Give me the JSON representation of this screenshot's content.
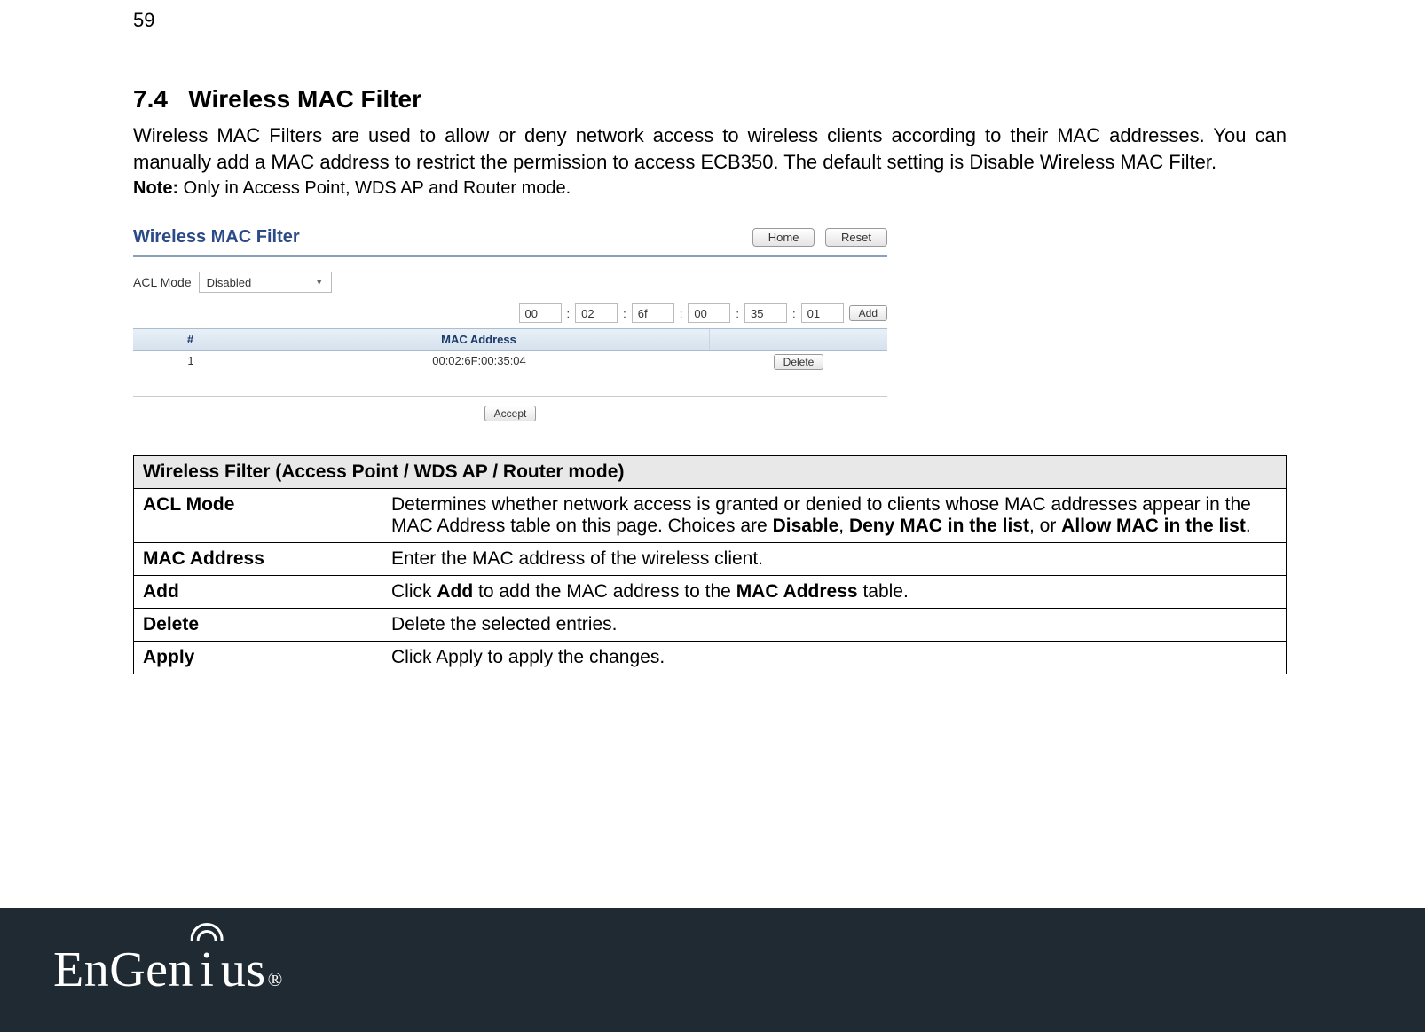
{
  "page_number": "59",
  "section": {
    "number": "7.4",
    "title": "Wireless MAC Filter"
  },
  "paragraph": "Wireless MAC Filters are used to allow or deny network access to wireless clients according to their MAC addresses. You can manually add a MAC address to restrict the permission to access ECB350. The default setting is Disable Wireless MAC Filter.",
  "note_label": "Note:",
  "note_text": " Only in Access Point, WDS AP and Router mode.",
  "shot": {
    "title": "Wireless MAC Filter",
    "home": "Home",
    "reset": "Reset",
    "acl_label": "ACL Mode",
    "acl_value": "Disabled",
    "mac_octets": [
      "00",
      "02",
      "6f",
      "00",
      "35",
      "01"
    ],
    "add": "Add",
    "head_num": "#",
    "head_mac": "MAC Address",
    "row_num": "1",
    "row_mac": "00:02:6F:00:35:04",
    "delete": "Delete",
    "accept": "Accept"
  },
  "table": {
    "caption": "Wireless Filter (Access Point / WDS AP / Router mode)",
    "rows": {
      "acl_mode_k": "ACL Mode",
      "acl_mode_v_pre": "Determines whether network access is granted or denied to clients whose MAC addresses appear in the MAC Address table on this page. Choices are ",
      "acl_mode_v_b1": "Disable",
      "acl_mode_v_mid1": ", ",
      "acl_mode_v_b2": "Deny MAC in the list",
      "acl_mode_v_mid2": ", or ",
      "acl_mode_v_b3": "Allow MAC in the list",
      "acl_mode_v_post": ".",
      "mac_k": "MAC Address",
      "mac_v": "Enter the MAC address of the wireless client.",
      "add_k": "Add",
      "add_v_pre": "Click ",
      "add_v_b1": "Add",
      "add_v_mid": " to add the MAC address to the ",
      "add_v_b2": "MAC Address",
      "add_v_post": " table.",
      "del_k": "Delete",
      "del_v": "Delete the selected entries.",
      "apply_k": "Apply",
      "apply_v": "Click Apply to apply the changes."
    }
  },
  "brand": {
    "pre": "EnGen",
    "i": "i",
    "post": "us",
    "reg": "®"
  }
}
